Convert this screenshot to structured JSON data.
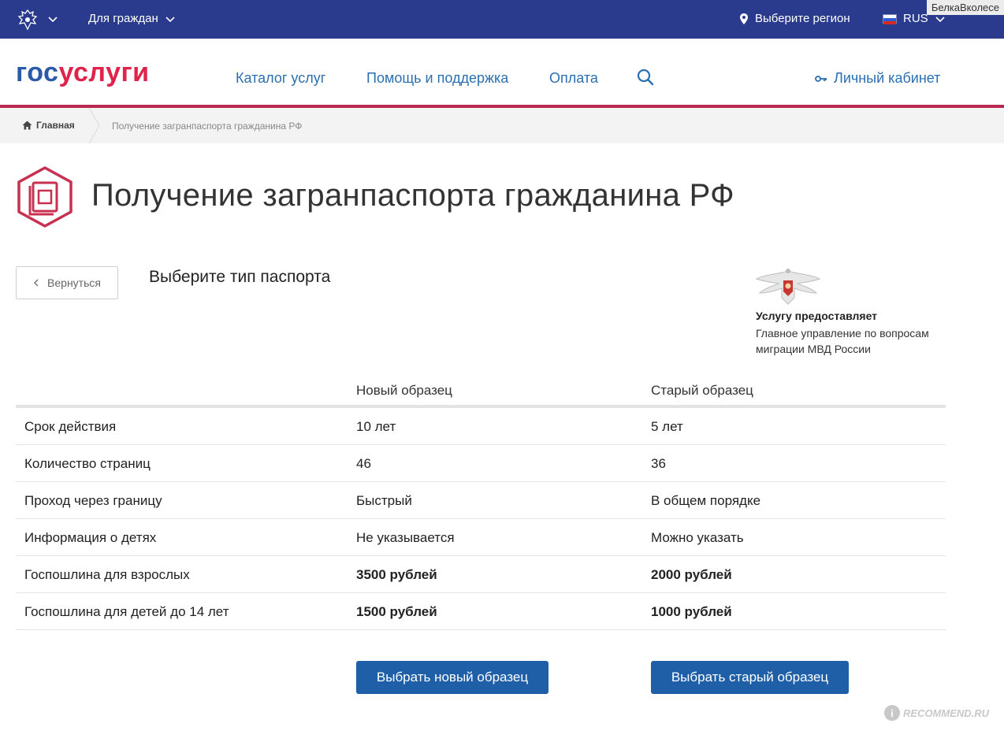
{
  "topbar": {
    "citizens_label": "Для граждан",
    "region_label": "Выберите регион",
    "language_label": "RUS",
    "watermark": "БелкаВколесе",
    "colors": {
      "background": "#2a3a8c"
    }
  },
  "header": {
    "logo_part1": "гос",
    "logo_part2": "услуги",
    "nav": {
      "catalog": "Каталог услуг",
      "help": "Помощь и поддержка",
      "payment": "Оплата"
    },
    "cabinet_label": "Личный кабинет",
    "colors": {
      "accent_border": "#b7294e",
      "link": "#2a6fb0"
    }
  },
  "breadcrumb": {
    "home": "Главная",
    "current": "Получение загранпаспорта гражданина РФ"
  },
  "page": {
    "title": "Получение загранпаспорта гражданина РФ",
    "back_label": "Вернуться",
    "choose_title": "Выберите тип паспорта"
  },
  "provider": {
    "label": "Услугу предоставляет",
    "name": "Главное управление по вопросам миграции МВД России"
  },
  "table": {
    "headers": [
      "",
      "Новый образец",
      "Старый образец"
    ],
    "rows": [
      {
        "label": "Срок действия",
        "new": "10 лет",
        "old": "5 лет"
      },
      {
        "label": "Количество страниц",
        "new": "46",
        "old": "36"
      },
      {
        "label": "Проход через границу",
        "new": "Быстрый",
        "old": "В общем порядке"
      },
      {
        "label": "Информация о детях",
        "new": "Не указывается",
        "old": "Можно указать"
      },
      {
        "label": "Госпошлина для взрослых",
        "new": "3500 рублей",
        "old": "2000 рублей"
      },
      {
        "label": "Госпошлина для детей до 14 лет",
        "new": "1500 рублей",
        "old": "1000 рублей"
      }
    ]
  },
  "actions": {
    "choose_new": "Выбрать новый образец",
    "choose_old": "Выбрать старый образец",
    "color": "#1f5fa8"
  },
  "watermark_bottom": "RECOMMEND.RU",
  "icons": [
    "emblem-icon",
    "chevron-down-icon",
    "location-pin-icon",
    "flag-icon",
    "search-icon",
    "key-icon",
    "home-icon",
    "passport-icon",
    "chevron-left-icon"
  ]
}
